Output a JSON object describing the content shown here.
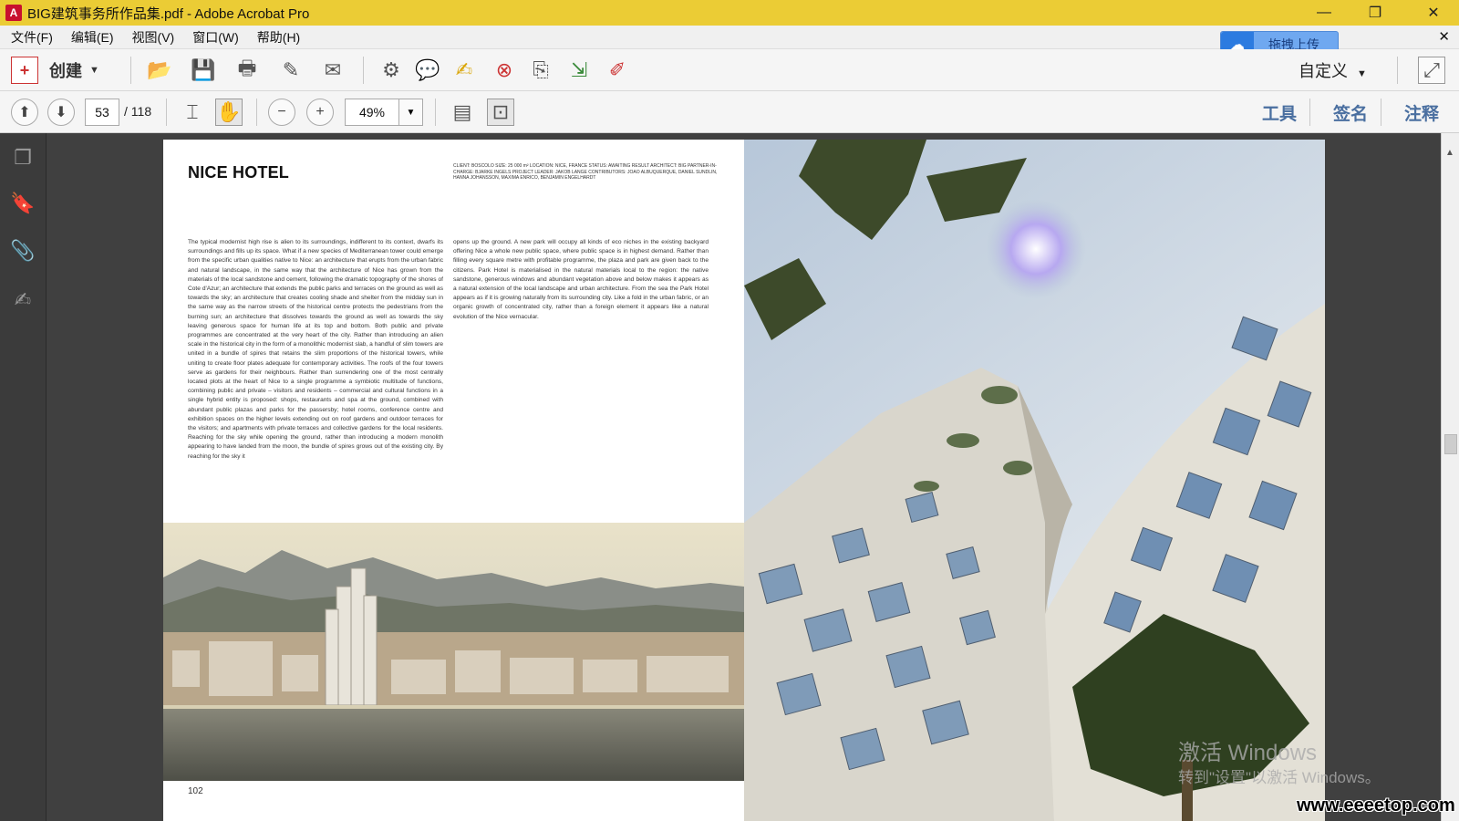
{
  "window": {
    "title": "BIG建筑事务所作品集.pdf - Adobe Acrobat Pro",
    "minimize": "—",
    "maximize": "❐",
    "close": "✕"
  },
  "menu": {
    "items": [
      "文件(F)",
      "编辑(E)",
      "视图(V)",
      "窗口(W)",
      "帮助(H)"
    ],
    "close_doc": "✕"
  },
  "upload": {
    "label": "拖拽上传"
  },
  "toolbar1": {
    "create_label": "创建",
    "custom_label": "自定义"
  },
  "toolbar2": {
    "current_page": "53",
    "total_pages": "/ 118",
    "zoom": "49%",
    "tabs": [
      "工具",
      "签名",
      "注释"
    ]
  },
  "document": {
    "title": "NICE HOTEL",
    "credits": "CLIENT: BOSCOLO  SIZE: 25 000 m²  LOCATION: NICE, FRANCE  STATUS: AWAITING RESULT  ARCHITECT: BIG  PARTNER-IN-CHARGE: BJARKE INGELS  PROJECT LEADER: JAKOB LANGE  CONTRIBUTORS: JOAO ALBUQUERQUE, DANIEL SUNDLIN, HANNA JOHANSSON, MAXIMA ENRICO, BENJAMIN ENGELHARDT",
    "col1": "The typical modernist high rise is alien to its surroundings, indifferent to its context, dwarfs its surroundings and fills up its space. What if a new species of Mediterranean tower could emerge from the specific urban qualities native to Nice: an architecture that erupts from the urban fabric and natural landscape, in the same way that the architecture of Nice has grown from the materials of the local sandstone and cement, following the dramatic topography of the shores of Cote d'Azur; an architecture that extends the public parks and terraces on the ground as well as towards the sky; an architecture that creates cooling shade and shelter from the midday sun in the same way as the narrow streets of the historical centre protects the pedestrians from the burning sun; an architecture that dissolves towards the ground as well as towards the sky leaving generous space for human life at its top and bottom. Both public and private programmes are concentrated at the very heart of the city. Rather than introducing an alien scale in the historical city in the form of a monolithic modernist slab, a handful of slim towers are united in a bundle of spires that retains the slim proportions of the historical towers, while uniting to create floor plates adequate for contemporary activities. The roofs of the four towers serve as gardens for their neighbours. Rather than surrendering one of the most centrally located plots at the heart of Nice to a single programme a symbiotic multitude of functions, combining public and private – visitors and residents – commercial and cultural functions in a single hybrid entity is proposed: shops, restaurants and spa at the ground, combined with abundant public plazas and parks for the passersby; hotel rooms, conference centre and exhibition spaces on the higher levels extending out on roof gardens and outdoor terraces for the visitors; and apartments with private terraces and collective gardens for the local residents. Reaching for the sky while opening the ground, rather than introducing a modern monolith appearing to have landed from the moon, the bundle of spires grows out of the existing city. By reaching for the sky it",
    "col2": "opens up the ground. A new park will occupy all kinds of eco niches in the existing backyard offering Nice a whole new public space, where public space is in highest demand. Rather than filling every square metre with profitable programme, the plaza and park are given back to the citizens. Park Hotel is materialised in the natural materials local to the region: the native sandstone, generous windows and abundant vegetation above and below makes it appears as a natural extension of the local landscape and urban architecture. From the sea the Park Hotel appears as if it is growing naturally from its surrounding city. Like a fold in the urban fabric, or an organic growth of concentrated city, rather than a foreign element it appears like a natural evolution of the Nice vernacular.",
    "page_number": "102"
  },
  "watermarks": {
    "activate": "激活 Windows",
    "activate_sub": "转到\"设置\"以激活 Windows。",
    "site": "www.eeeetop.com"
  },
  "colors": {
    "titlebar": "#ebcc35",
    "tab_blue": "#4a6fa0",
    "doc_bg": "#404040"
  }
}
